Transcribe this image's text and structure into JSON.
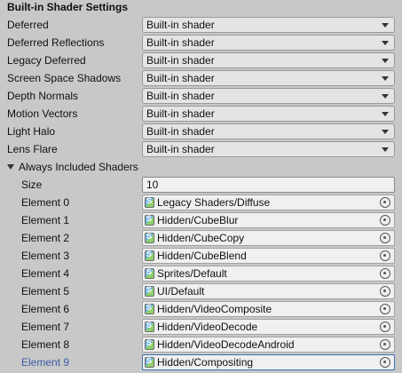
{
  "section_title": "Built-in Shader Settings",
  "settings": [
    {
      "label": "Deferred",
      "value": "Built-in shader"
    },
    {
      "label": "Deferred Reflections",
      "value": "Built-in shader"
    },
    {
      "label": "Legacy Deferred",
      "value": "Built-in shader"
    },
    {
      "label": "Screen Space Shadows",
      "value": "Built-in shader"
    },
    {
      "label": "Depth Normals",
      "value": "Built-in shader"
    },
    {
      "label": "Motion Vectors",
      "value": "Built-in shader"
    },
    {
      "label": "Light Halo",
      "value": "Built-in shader"
    },
    {
      "label": "Lens Flare",
      "value": "Built-in shader"
    }
  ],
  "always_included": {
    "label": "Always Included Shaders",
    "size_label": "Size",
    "size_value": "10",
    "elements": [
      {
        "label": "Element 0",
        "value": "Legacy Shaders/Diffuse"
      },
      {
        "label": "Element 1",
        "value": "Hidden/CubeBlur"
      },
      {
        "label": "Element 2",
        "value": "Hidden/CubeCopy"
      },
      {
        "label": "Element 3",
        "value": "Hidden/CubeBlend"
      },
      {
        "label": "Element 4",
        "value": "Sprites/Default"
      },
      {
        "label": "Element 5",
        "value": "UI/Default"
      },
      {
        "label": "Element 6",
        "value": "Hidden/VideoComposite"
      },
      {
        "label": "Element 7",
        "value": "Hidden/VideoDecode"
      },
      {
        "label": "Element 8",
        "value": "Hidden/VideoDecodeAndroid"
      },
      {
        "label": "Element 9",
        "value": "Hidden/Compositing"
      }
    ]
  },
  "icons": {
    "shader": "shader-file-icon",
    "picker": "object-picker-icon",
    "dropdown": "dropdown-arrow-icon",
    "foldout": "foldout-triangle-icon"
  },
  "colors": {
    "background": "#c8c8c8",
    "selected_label": "#3a5da8",
    "selected_border": "#3a72b0"
  }
}
